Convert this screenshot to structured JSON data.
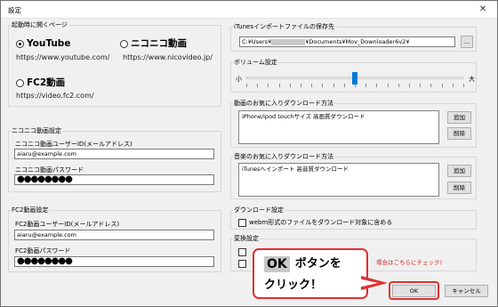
{
  "window": {
    "title": "設定",
    "close_glyph": "✕"
  },
  "startup": {
    "group_title": "起動時に開くページ",
    "options": [
      {
        "label": "YouTube",
        "url": "https://www.youtube.com/",
        "selected": true
      },
      {
        "label": "ニコニコ動画",
        "url": "https://www.nicovideo.jp/",
        "selected": false
      },
      {
        "label": "FC2動画",
        "url": "https://video.fc2.com/",
        "selected": false
      }
    ]
  },
  "nico": {
    "group_title": "ニコニコ動画設定",
    "user_label": "ニコニコ動画ユーザーID(メールアドレス)",
    "user_value": "aiaru@example.com",
    "pass_label": "ニコニコ動画パスワード",
    "pass_value": "●●●●●●●●"
  },
  "fc2": {
    "group_title": "FC2動画設定",
    "user_label": "FC2動画ユーザーID(メールアドレス)",
    "user_value": "aiaru@example.com",
    "pass_label": "FC2動画パスワード",
    "pass_value": "●●●●●●●●"
  },
  "itunes": {
    "group_title": "iTunesインポートファイルの保存先",
    "path_prefix": "C:¥Users¥",
    "path_suffix": "¥Documents¥Mov_Downloader6v2¥",
    "browse_label": "..."
  },
  "volume": {
    "group_title": "ボリューム設定",
    "min_label": "小",
    "max_label": "大",
    "level": 0.5
  },
  "video_fav": {
    "group_title": "動画のお気に入りダウンロード方法",
    "items": [
      "iPhone/ipod touchサイズ 高画質ダウンロード"
    ],
    "add_label": "追加",
    "delete_label": "削除"
  },
  "music_fav": {
    "group_title": "音楽のお気に入りダウンロード方法",
    "items": [
      "iTunesへインポート 高音質ダウンロード"
    ],
    "add_label": "追加",
    "delete_label": "削除"
  },
  "download": {
    "group_title": "ダウンロード設定",
    "webm_label": "webm形式のファイルをダウンロード対象に含める"
  },
  "convert": {
    "group_title": "変換設定",
    "note": "場合はこちらにチェック)"
  },
  "footer": {
    "ok_label": "OK",
    "cancel_label": "キャンセル"
  },
  "callout": {
    "ok_chip": "OK",
    "line1": "ボタンを",
    "line2": "クリック！"
  },
  "colors": {
    "accent": "#0078d7",
    "callout_red": "#e03030",
    "note_red": "#d62020"
  }
}
